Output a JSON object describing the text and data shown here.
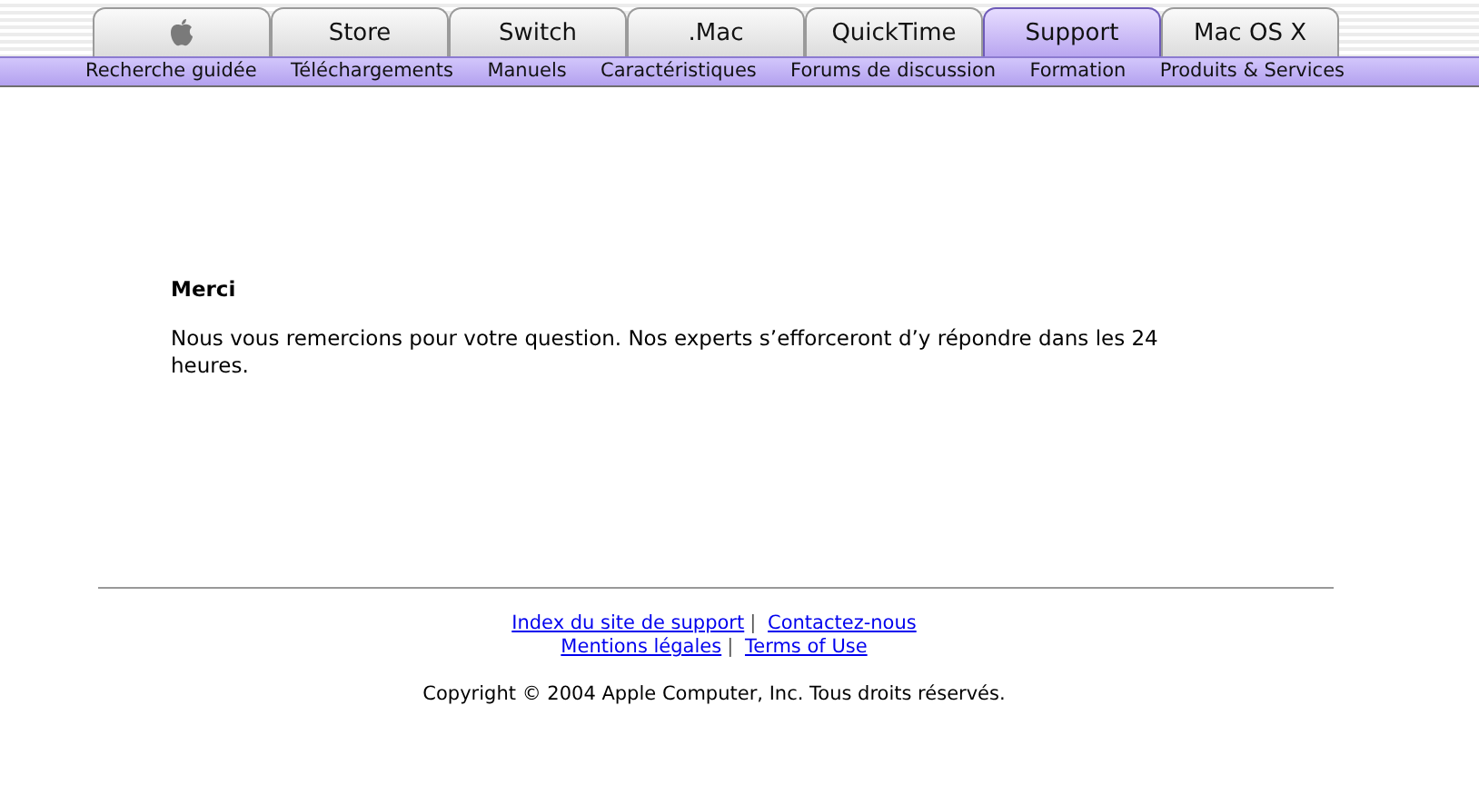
{
  "tabs": [
    {
      "kind": "icon",
      "selected": false
    },
    {
      "kind": "text",
      "label": "Store",
      "selected": false
    },
    {
      "kind": "text",
      "label": "Switch",
      "selected": false
    },
    {
      "kind": "text",
      "label": ".Mac",
      "selected": false
    },
    {
      "kind": "text",
      "label": "QuickTime",
      "selected": false
    },
    {
      "kind": "text",
      "label": "Support",
      "selected": true
    },
    {
      "kind": "text",
      "label": "Mac OS X",
      "selected": false
    }
  ],
  "subnav": [
    "Recherche guidée",
    "Téléchargements",
    "Manuels",
    "Caractéristiques",
    "Forums de discussion",
    "Formation",
    "Produits & Services"
  ],
  "message": {
    "title": "Merci",
    "body": "Nous vous remercions pour votre question. Nos experts s’efforceront d’y répondre dans les 24 heures."
  },
  "footer": {
    "link_lines": [
      {
        "links": [
          "Index du site de support",
          "Contactez-nous"
        ],
        "separator": "|"
      },
      {
        "links": [
          "Mentions légales",
          "Terms of Use"
        ],
        "separator": "|"
      }
    ],
    "copyright": "Copyright © 2004 Apple Computer, Inc. Tous droits réservés."
  }
}
